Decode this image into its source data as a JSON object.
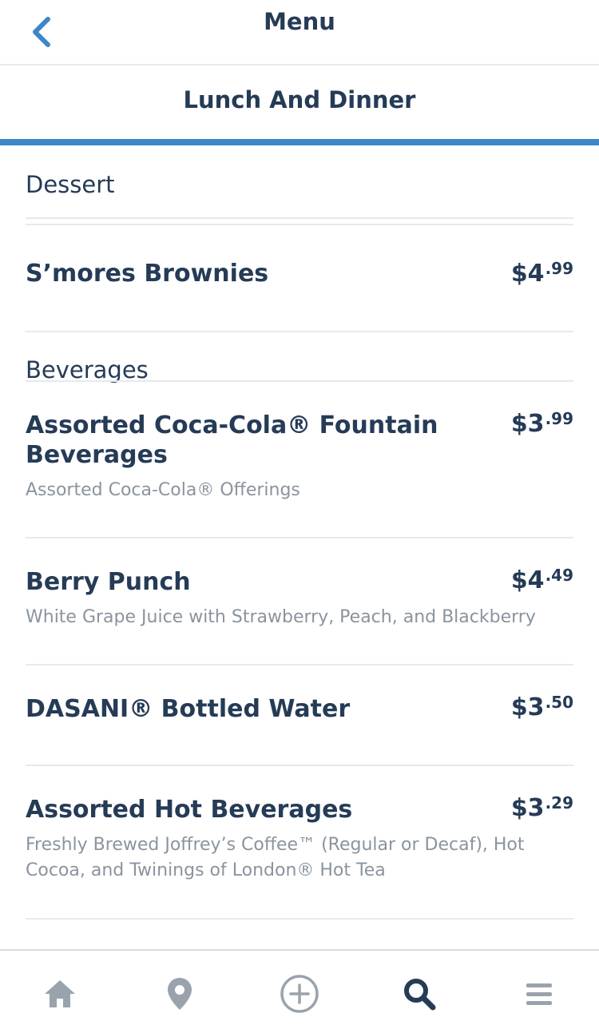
{
  "nav": {
    "title": "Menu",
    "back_icon": "chevron-left-icon"
  },
  "subheader": {
    "title": "Lunch And Dinner"
  },
  "colors": {
    "accent": "#3d87c8",
    "text": "#253b56",
    "muted": "#8a949f",
    "divider": "#e6eaee",
    "tab_inactive": "#9aa3ad"
  },
  "sections": {
    "dessert": {
      "label": "Dessert",
      "items": [
        {
          "name": "S’mores Brownies",
          "price_dollars": "$4",
          "price_cents": ".99"
        }
      ]
    },
    "beverages": {
      "label": "Beverages",
      "items": [
        {
          "name": "Assorted Coca-Cola® Fountain Beverages",
          "price_dollars": "$3",
          "price_cents": ".99",
          "desc": "Assorted Coca-Cola® Offerings"
        },
        {
          "name": "Berry Punch",
          "price_dollars": "$4",
          "price_cents": ".49",
          "desc": "White Grape Juice with Strawberry, Peach, and Blackberry"
        },
        {
          "name": "DASANI® Bottled Water",
          "price_dollars": "$3",
          "price_cents": ".50"
        },
        {
          "name": "Assorted Hot Beverages",
          "price_dollars": "$3",
          "price_cents": ".29",
          "desc": "Freshly Brewed Joffrey’s Coffee™ (Regular or Decaf), Hot Cocoa, and Twinings of London® Hot Tea"
        }
      ]
    }
  },
  "tabbar": {
    "items": [
      {
        "icon": "home-icon",
        "active": false
      },
      {
        "icon": "location-pin-icon",
        "active": false
      },
      {
        "icon": "plus-circle-icon",
        "active": false
      },
      {
        "icon": "search-icon",
        "active": true
      },
      {
        "icon": "hamburger-menu-icon",
        "active": false
      }
    ]
  }
}
